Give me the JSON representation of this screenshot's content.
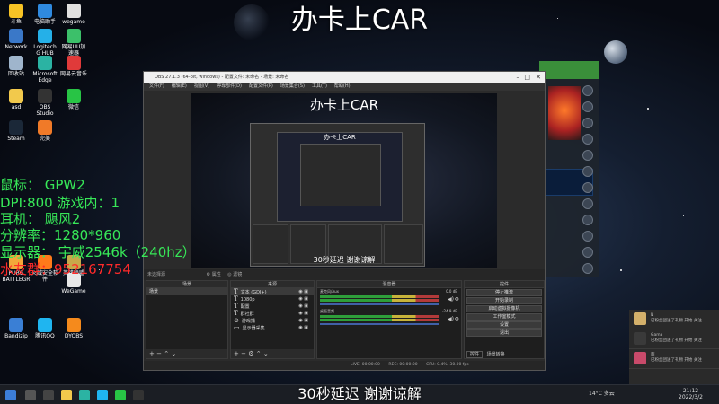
{
  "stream_title": "办卡上CAR",
  "overlay_text": {
    "mouse": "鼠标：  GPW2",
    "dpi": "DPI:800 游戏内：1",
    "headset": "耳机：  飓风2",
    "resolution": "分辨率：1280*960",
    "monitor": "显示器：  宇威2546k（240hz）",
    "qq_group": "水友群：952167754"
  },
  "desktop_icons": [
    {
      "label": "斗鱼",
      "color": "#f7c325"
    },
    {
      "label": "电脑助手",
      "color": "#2f8ae0"
    },
    {
      "label": "wegame",
      "color": "#e0e0e0"
    },
    {
      "label": "Network",
      "color": "#3a78c8"
    },
    {
      "label": "Logitech G HUB",
      "color": "#25b0e8"
    },
    {
      "label": "网易UU加速器",
      "color": "#3cc06a"
    },
    {
      "label": "回收站",
      "color": "#9fb5cc"
    },
    {
      "label": "Microsoft Edge",
      "color": "#2bb3a3"
    },
    {
      "label": "网易云音乐",
      "color": "#e03a3a"
    },
    {
      "label": "asd",
      "color": "#f2c94c"
    },
    {
      "label": "OBS Studio",
      "color": "#333333"
    },
    {
      "label": "微信",
      "color": "#28c445"
    },
    {
      "label": "Steam",
      "color": "#1b2838"
    },
    {
      "label": "完美",
      "color": "#f07a28"
    },
    {
      "label": "PUBG BATTLEGR",
      "color": "#f2a83a"
    },
    {
      "label": "火绒安全软件",
      "color": "#ff7a1a"
    },
    {
      "label": "英雄联盟",
      "color": "#c8a84a"
    },
    {
      "label": "WeGame",
      "color": "#e8e8e8"
    },
    {
      "label": "Bandizip",
      "color": "#3a7fd5"
    },
    {
      "label": "腾讯QQ",
      "color": "#1fb5f0"
    },
    {
      "label": "DYOBS",
      "color": "#f58a1c"
    }
  ],
  "obs": {
    "window_title": "OBS 27.1.3 (64-bit, windows) - 配置文件: 未命名 - 场景: 未命名",
    "menu": [
      "文件(F)",
      "编辑(E)",
      "视图(V)",
      "停靠部件(D)",
      "配置文件(P)",
      "场景集合(S)",
      "工具(T)",
      "帮助(H)"
    ],
    "preview_title": "办卡上CAR",
    "preview_subtitle": "30秒延迟 谢谢谅解",
    "toolbar": {
      "no_source": "未选择源",
      "properties": "属性",
      "filters": "滤镜"
    },
    "docks": {
      "scenes": {
        "header": "场景",
        "items": [
          "场景"
        ]
      },
      "sources": {
        "header": "来源",
        "items": [
          {
            "name": "文本 (GDI+)",
            "type": "T"
          },
          {
            "name": "1080p",
            "type": "T"
          },
          {
            "name": "配置",
            "type": "T"
          },
          {
            "name": "群社群",
            "type": "T"
          },
          {
            "name": "游戏捕",
            "type": "game"
          },
          {
            "name": "显示器采集",
            "type": "display"
          }
        ]
      },
      "mixer": {
        "header": "混音器",
        "tracks": [
          {
            "name": "麦克风/Aux",
            "db": "0.0 dB"
          },
          {
            "name": "桌面音频",
            "db": "-24.9 dB"
          }
        ]
      },
      "controls": {
        "header": "控件",
        "buttons": [
          "停止推流",
          "开始录制",
          "启动虚拟摄像机",
          "工作室模式",
          "设置",
          "退出"
        ]
      }
    },
    "tabs": [
      "控件",
      "场景转换"
    ],
    "status": {
      "live": "LIVE: 00:00:00",
      "rec": "REC: 00:00:00",
      "cpu": "CPU: 0.4%, 30.00 fps"
    }
  },
  "notifications": [
    {
      "name": "N",
      "text": "已粉丝团送了礼物 开始 关注",
      "color": "#d4b06a"
    },
    {
      "name": "Gama",
      "text": "已粉丝团送了礼物 开始 关注",
      "color": "#3a3a3a"
    },
    {
      "name": "雨",
      "text": "已粉丝团送了礼物 开始 关注",
      "color": "#c84a6a"
    }
  ],
  "taskbar": {
    "weather": "14°C 多云",
    "time": "21:12",
    "date": "2022/3/2"
  },
  "subtitle": "30秒延迟 谢谢谅解"
}
